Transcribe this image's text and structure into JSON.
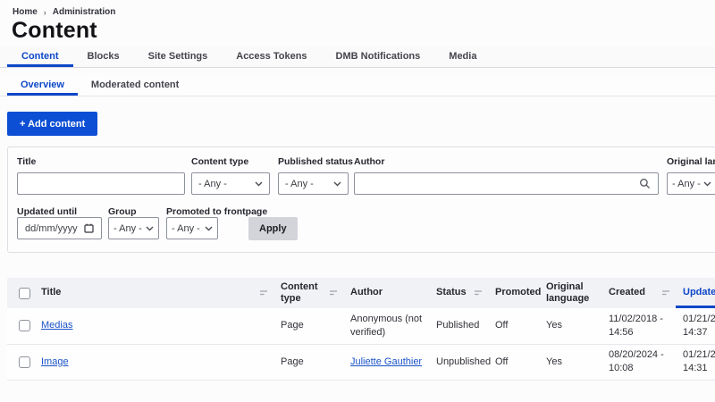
{
  "breadcrumb": {
    "separator": "›",
    "items": [
      "Home",
      "Administration"
    ]
  },
  "page": {
    "title": "Content"
  },
  "tabs": {
    "items": [
      {
        "label": "Content",
        "active": true
      },
      {
        "label": "Blocks",
        "active": false
      },
      {
        "label": "Site Settings",
        "active": false
      },
      {
        "label": "Access Tokens",
        "active": false
      },
      {
        "label": "DMB Notifications",
        "active": false
      },
      {
        "label": "Media",
        "active": false
      }
    ]
  },
  "subtabs": {
    "items": [
      {
        "label": "Overview",
        "active": true
      },
      {
        "label": "Moderated content",
        "active": false
      }
    ]
  },
  "actions": {
    "add_content_label": "+ Add content"
  },
  "filters": {
    "title": {
      "label": "Title",
      "value": ""
    },
    "content_type": {
      "label": "Content type",
      "value": "- Any -"
    },
    "published_status": {
      "label": "Published status",
      "value": "- Any -"
    },
    "author": {
      "label": "Author",
      "value": ""
    },
    "original_language": {
      "label": "Original language",
      "value": "- Any -"
    },
    "updated_until": {
      "label": "Updated until",
      "placeholder": "dd/mm/yyyy"
    },
    "group": {
      "label": "Group",
      "value": "- Any -"
    },
    "promoted_to_frontpage": {
      "label": "Promoted to frontpage",
      "value": "- Any -"
    },
    "apply_label": "Apply"
  },
  "table": {
    "columns": {
      "title": "Title",
      "content_type": "Content type",
      "author": "Author",
      "status": "Status",
      "promoted": "Promoted",
      "original_language": "Original language",
      "created": "Created",
      "updated": "Updated"
    },
    "rows": [
      {
        "title": "Medias",
        "content_type": "Page",
        "author": "Anonymous (not verified)",
        "author_is_link": false,
        "status": "Published",
        "promoted": "Off",
        "original_language": "Yes",
        "created": "11/02/2018 -\n14:56",
        "updated": "01/21/2\n14:37"
      },
      {
        "title": "Image",
        "content_type": "Page",
        "author": "Juliette Gauthier",
        "author_is_link": true,
        "status": "Unpublished",
        "promoted": "Off",
        "original_language": "Yes",
        "created": "08/20/2024 -\n10:08",
        "updated": "01/21/2\n14:31"
      }
    ]
  },
  "colors": {
    "accent_blue": "#0d47c8",
    "button_blue": "#0c4fd4",
    "link_blue": "#1a53c8",
    "apply_gray": "#d3d4d9",
    "table_header_bg": "#f1f2f6"
  }
}
